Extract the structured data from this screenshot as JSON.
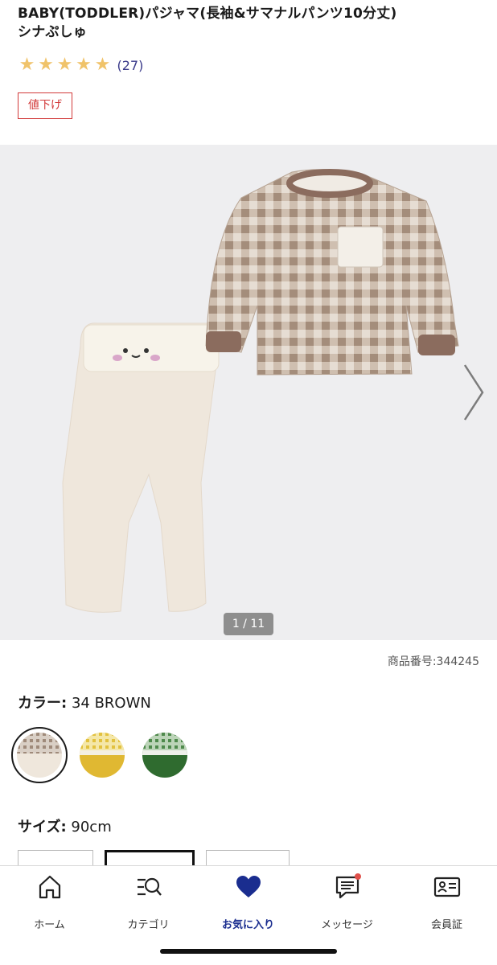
{
  "product": {
    "title_line1": "BABY(TODDLER)パジャマ(長袖&サマナルパンツ10分丈)",
    "title_line2": "シナぷしゅ",
    "rating_count": "(27)",
    "rating_stars": 5,
    "price_badge": "値下げ",
    "product_number": "商品番号:344245"
  },
  "gallery": {
    "counter": "1 / 11"
  },
  "color": {
    "label": "カラー:",
    "value": "34 BROWN",
    "swatches": [
      "brown-check",
      "yellow-check",
      "green-check"
    ]
  },
  "size": {
    "label": "サイズ:",
    "value": "90cm"
  },
  "tabs": [
    {
      "label": "ホーム",
      "icon": "home-icon"
    },
    {
      "label": "カテゴリ",
      "icon": "category-search-icon"
    },
    {
      "label": "お気に入り",
      "icon": "heart-icon"
    },
    {
      "label": "メッセージ",
      "icon": "message-icon"
    },
    {
      "label": "会員証",
      "icon": "member-card-icon"
    }
  ],
  "colors": {
    "accent_red": "#d23a3a",
    "tab_active": "#1a2d8f",
    "star": "#f0c36a"
  }
}
